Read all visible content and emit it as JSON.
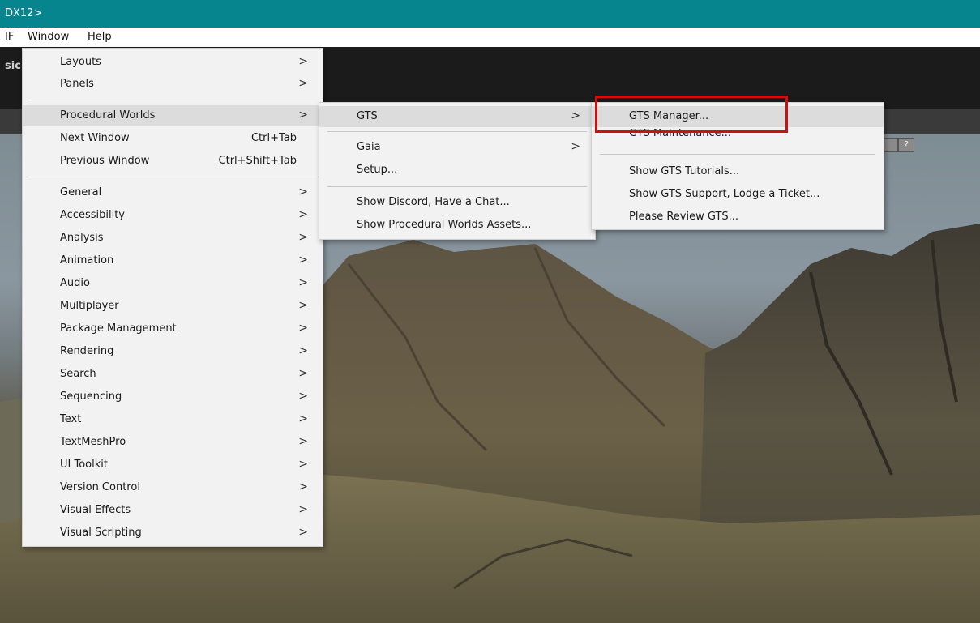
{
  "title_bar": {
    "text": "DX12>"
  },
  "menu_bar": {
    "items": [
      "IF",
      "Window",
      "Help"
    ]
  },
  "toolbar": {
    "partial_label": "sic"
  },
  "scene": {
    "help_icon_glyph": "?"
  },
  "window_menu": {
    "items": [
      {
        "label": "Layouts",
        "submenu": true
      },
      {
        "label": "Panels",
        "submenu": true
      },
      {
        "label": "Procedural Worlds",
        "submenu": true
      },
      {
        "label": "Next Window",
        "shortcut": "Ctrl+Tab"
      },
      {
        "label": "Previous Window",
        "shortcut": "Ctrl+Shift+Tab"
      },
      {
        "label": "General",
        "submenu": true
      },
      {
        "label": "Accessibility",
        "submenu": true
      },
      {
        "label": "Analysis",
        "submenu": true
      },
      {
        "label": "Animation",
        "submenu": true
      },
      {
        "label": "Audio",
        "submenu": true
      },
      {
        "label": "Multiplayer",
        "submenu": true
      },
      {
        "label": "Package Management",
        "submenu": true
      },
      {
        "label": "Rendering",
        "submenu": true
      },
      {
        "label": "Search",
        "submenu": true
      },
      {
        "label": "Sequencing",
        "submenu": true
      },
      {
        "label": "Text",
        "submenu": true
      },
      {
        "label": "TextMeshPro",
        "submenu": true
      },
      {
        "label": "UI Toolkit",
        "submenu": true
      },
      {
        "label": "Version Control",
        "submenu": true
      },
      {
        "label": "Visual Effects",
        "submenu": true
      },
      {
        "label": "Visual Scripting",
        "submenu": true
      }
    ],
    "arrow_glyph": ">"
  },
  "pw_menu": {
    "items": [
      {
        "label": "GTS",
        "submenu": true
      },
      {
        "label": "Gaia",
        "submenu": true
      },
      {
        "label": "Setup..."
      },
      {
        "label": "Show Discord, Have a Chat..."
      },
      {
        "label": "Show Procedural Worlds Assets..."
      }
    ]
  },
  "gts_menu": {
    "items": [
      {
        "label": "GTS Manager..."
      },
      {
        "label": "GTS Maintenance..."
      },
      {
        "label": "Show GTS Tutorials..."
      },
      {
        "label": "Show GTS Support, Lodge a Ticket..."
      },
      {
        "label": "Please Review GTS..."
      }
    ]
  },
  "colors": {
    "title_bar": "#06858f",
    "menu_bg": "#f2f2f2",
    "highlight": "#dcdcdc",
    "callout_border": "#d01010"
  }
}
